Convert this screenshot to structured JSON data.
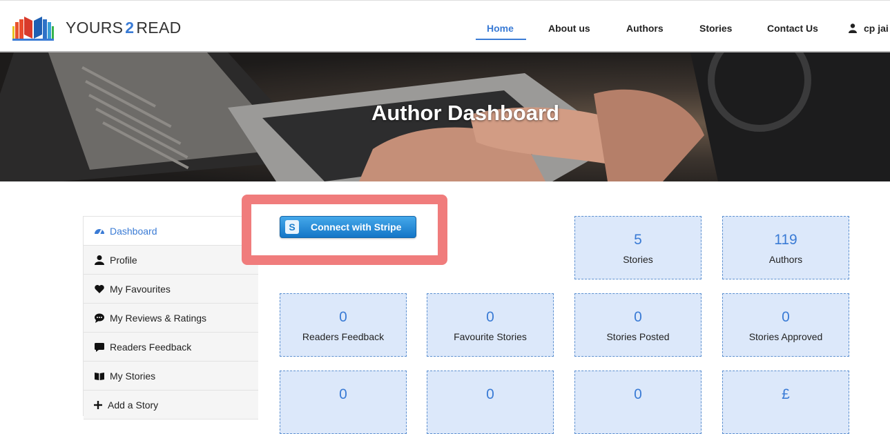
{
  "header": {
    "brand_left": "YOURS",
    "brand_num": "2",
    "brand_right": "READ",
    "nav": [
      {
        "label": "Home",
        "active": true
      },
      {
        "label": "About us"
      },
      {
        "label": "Authors"
      },
      {
        "label": "Stories"
      },
      {
        "label": "Contact Us"
      }
    ],
    "user_name": "cp jai",
    "accent_color": "#3a7bd5"
  },
  "hero": {
    "title": "Author Dashboard"
  },
  "sidebar": {
    "items": [
      {
        "label": "Dashboard",
        "icon": "dashboard-icon",
        "active": true
      },
      {
        "label": "Profile",
        "icon": "user-icon"
      },
      {
        "label": "My Favourites",
        "icon": "heart-icon"
      },
      {
        "label": "My Reviews & Ratings",
        "icon": "comments-icon"
      },
      {
        "label": "Readers Feedback",
        "icon": "comment-icon"
      },
      {
        "label": "My Stories",
        "icon": "book-icon"
      },
      {
        "label": "Add a Story",
        "icon": "plus-icon"
      }
    ]
  },
  "stripe": {
    "label": "Connect with Stripe",
    "logo_letter": "S"
  },
  "stats": [
    {
      "value": "5",
      "label": "Stories"
    },
    {
      "value": "119",
      "label": "Authors"
    },
    {
      "value": "0",
      "label": "Readers Feedback"
    },
    {
      "value": "0",
      "label": "Favourite Stories"
    },
    {
      "value": "0",
      "label": "Stories Posted"
    },
    {
      "value": "0",
      "label": "Stories Approved"
    },
    {
      "value": "0",
      "label": ""
    },
    {
      "value": "0",
      "label": ""
    },
    {
      "value": "0",
      "label": ""
    },
    {
      "value": "£",
      "label": ""
    }
  ]
}
